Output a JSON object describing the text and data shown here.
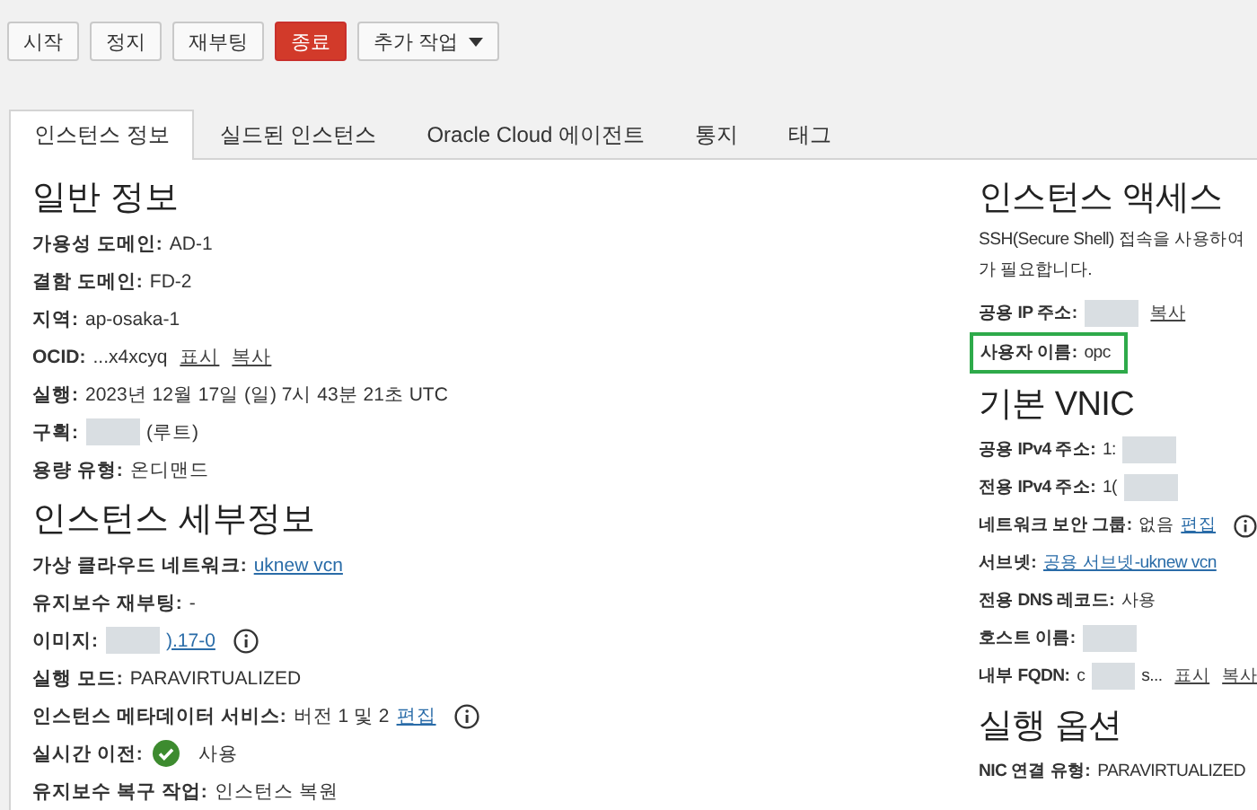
{
  "actions": [
    {
      "label": "시작",
      "kind": "default"
    },
    {
      "label": "정지",
      "kind": "default"
    },
    {
      "label": "재부팅",
      "kind": "default"
    },
    {
      "label": "종료",
      "kind": "danger"
    },
    {
      "label": "추가 작업",
      "kind": "menu"
    }
  ],
  "tabs": [
    {
      "label": "인스턴스 정보",
      "selected": true
    },
    {
      "label": "실드된 인스턴스",
      "selected": false
    },
    {
      "label": "Oracle Cloud 에이전트",
      "selected": false
    },
    {
      "label": "통지",
      "selected": false
    },
    {
      "label": "태그",
      "selected": false
    }
  ],
  "left_sections": [
    {
      "title": "일반 정보",
      "rows": [
        {
          "label": "가용성 도메인:",
          "parts": [
            {
              "kind": "text",
              "text": "AD-1"
            }
          ]
        },
        {
          "label": "결함 도메인:",
          "parts": [
            {
              "kind": "text",
              "text": "FD-2"
            }
          ]
        },
        {
          "label": "지역:",
          "parts": [
            {
              "kind": "text",
              "text": "ap-osaka-1"
            }
          ]
        },
        {
          "label": "OCID:",
          "parts": [
            {
              "kind": "text",
              "text": "...x4xcyq"
            },
            {
              "kind": "action",
              "text": "표시"
            },
            {
              "kind": "action",
              "text": "복사"
            }
          ]
        },
        {
          "label": "실행:",
          "parts": [
            {
              "kind": "text",
              "text": "2023년 12월 17일 (일) 7시 43분 21초 UTC"
            }
          ]
        },
        {
          "label": "구획:",
          "parts": [
            {
              "kind": "redacted"
            },
            {
              "kind": "text",
              "text": "(루트)"
            }
          ]
        },
        {
          "label": "용량 유형:",
          "parts": [
            {
              "kind": "text",
              "text": "온디맨드"
            }
          ]
        }
      ]
    },
    {
      "title": "인스턴스 세부정보",
      "rows": [
        {
          "label": "가상 클라우드 네트워크:",
          "parts": [
            {
              "kind": "link",
              "text": "uknew vcn"
            }
          ]
        },
        {
          "label": "유지보수 재부팅:",
          "parts": [
            {
              "kind": "text",
              "text": "-"
            }
          ]
        },
        {
          "label": "이미지:",
          "parts": [
            {
              "kind": "redacted"
            },
            {
              "kind": "link",
              "text": ").17-0"
            },
            {
              "kind": "info"
            }
          ]
        },
        {
          "label": "실행 모드:",
          "parts": [
            {
              "kind": "text",
              "text": "PARAVIRTUALIZED"
            }
          ]
        },
        {
          "label": "인스턴스 메타데이터 서비스:",
          "parts": [
            {
              "kind": "text",
              "text": "버전 1 및 2"
            },
            {
              "kind": "link",
              "text": "편집"
            },
            {
              "kind": "info"
            }
          ]
        },
        {
          "label": "실시간 이전:",
          "parts": [
            {
              "kind": "check"
            },
            {
              "kind": "text",
              "text": "사용"
            }
          ]
        },
        {
          "label": "유지보수 복구 작업:",
          "parts": [
            {
              "kind": "text",
              "text": "인스턴스 복원"
            }
          ]
        }
      ]
    }
  ],
  "right_sections": [
    {
      "title": "인스턴스 액세스",
      "notes": [
        "SSH(Secure Shell) 접속을 사용하여",
        "가 필요합니다."
      ],
      "rows": [
        {
          "label": "공용 IP 주소:",
          "highlighted": false,
          "parts": [
            {
              "kind": "redacted"
            },
            {
              "kind": "action",
              "text": "복사"
            }
          ]
        },
        {
          "label": "사용자 이름:",
          "highlighted": true,
          "parts": [
            {
              "kind": "text",
              "text": "opc"
            }
          ]
        }
      ]
    },
    {
      "title": "기본 VNIC",
      "rows": [
        {
          "label": "공용 IPv4 주소:",
          "highlighted": false,
          "parts": [
            {
              "kind": "text",
              "text": "1:"
            },
            {
              "kind": "redacted"
            }
          ]
        },
        {
          "label": "전용 IPv4 주소:",
          "highlighted": false,
          "parts": [
            {
              "kind": "text",
              "text": "1("
            },
            {
              "kind": "redacted"
            }
          ]
        },
        {
          "label": "네트워크 보안 그룹:",
          "highlighted": false,
          "parts": [
            {
              "kind": "text",
              "text": "없음"
            },
            {
              "kind": "link",
              "text": "편집"
            },
            {
              "kind": "info"
            }
          ]
        },
        {
          "label": "서브넷:",
          "highlighted": false,
          "parts": [
            {
              "kind": "link",
              "text": "공용 서브넷-uknew vcn"
            }
          ]
        },
        {
          "label": "전용 DNS 레코드:",
          "highlighted": false,
          "parts": [
            {
              "kind": "text",
              "text": "사용"
            }
          ]
        },
        {
          "label": "호스트 이름:",
          "highlighted": false,
          "parts": [
            {
              "kind": "redacted"
            }
          ]
        },
        {
          "label": "내부 FQDN:",
          "highlighted": false,
          "parts": [
            {
              "kind": "text",
              "text": "c"
            },
            {
              "kind": "redacted"
            },
            {
              "kind": "text",
              "text": "s..."
            },
            {
              "kind": "action",
              "text": "표시"
            },
            {
              "kind": "action",
              "text": "복사"
            }
          ]
        }
      ]
    },
    {
      "title": "실행 옵션",
      "rows": [
        {
          "label": "NIC 연결 유형:",
          "highlighted": false,
          "parts": [
            {
              "kind": "text",
              "text": "PARAVIRTUALIZED"
            }
          ]
        }
      ]
    }
  ]
}
